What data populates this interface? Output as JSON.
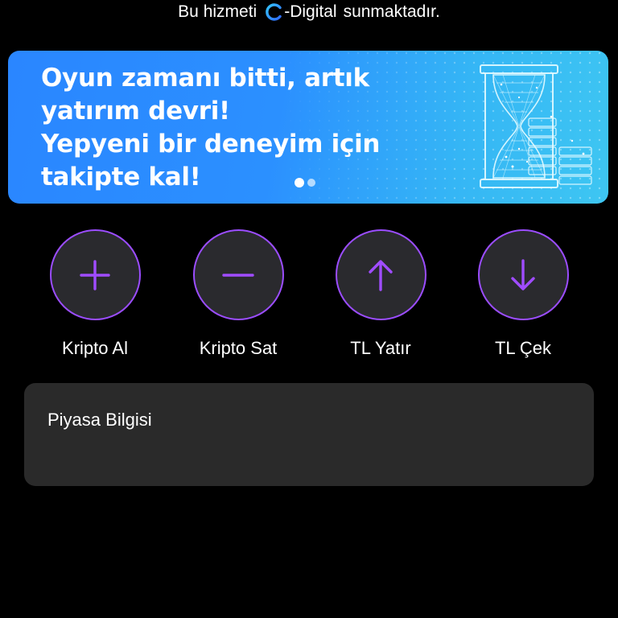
{
  "provider": {
    "prefix": "Bu hizmeti",
    "brand": "-Digital",
    "suffix": "sunmaktadır.",
    "logo_icon": "c-digital-logo-icon",
    "logo_colors": [
      "#35c6ff",
      "#2f6bff"
    ]
  },
  "banner": {
    "headline_lines": [
      "Oyun zamanı bitti, artık",
      "yatırım devri!",
      "Yepyeni bir deneyim için",
      "takipte kal!"
    ],
    "illustration_icon": "hourglass-icon",
    "slides_total": 2,
    "active_slide": 1,
    "gradient_colors": [
      "#2a86ff",
      "#3ec6f2"
    ]
  },
  "actions": [
    {
      "label": "Kripto Al",
      "icon": "plus-icon"
    },
    {
      "label": "Kripto Sat",
      "icon": "minus-icon"
    },
    {
      "label": "TL Yatır",
      "icon": "arrow-up-icon"
    },
    {
      "label": "TL Çek",
      "icon": "arrow-down-icon"
    }
  ],
  "market": {
    "title": "Piyasa Bilgisi"
  },
  "colors": {
    "background": "#000000",
    "accent": "#9b4dff",
    "button_fill": "#2a2a2e",
    "card": "#2a2a2a",
    "text": "#ffffff"
  }
}
